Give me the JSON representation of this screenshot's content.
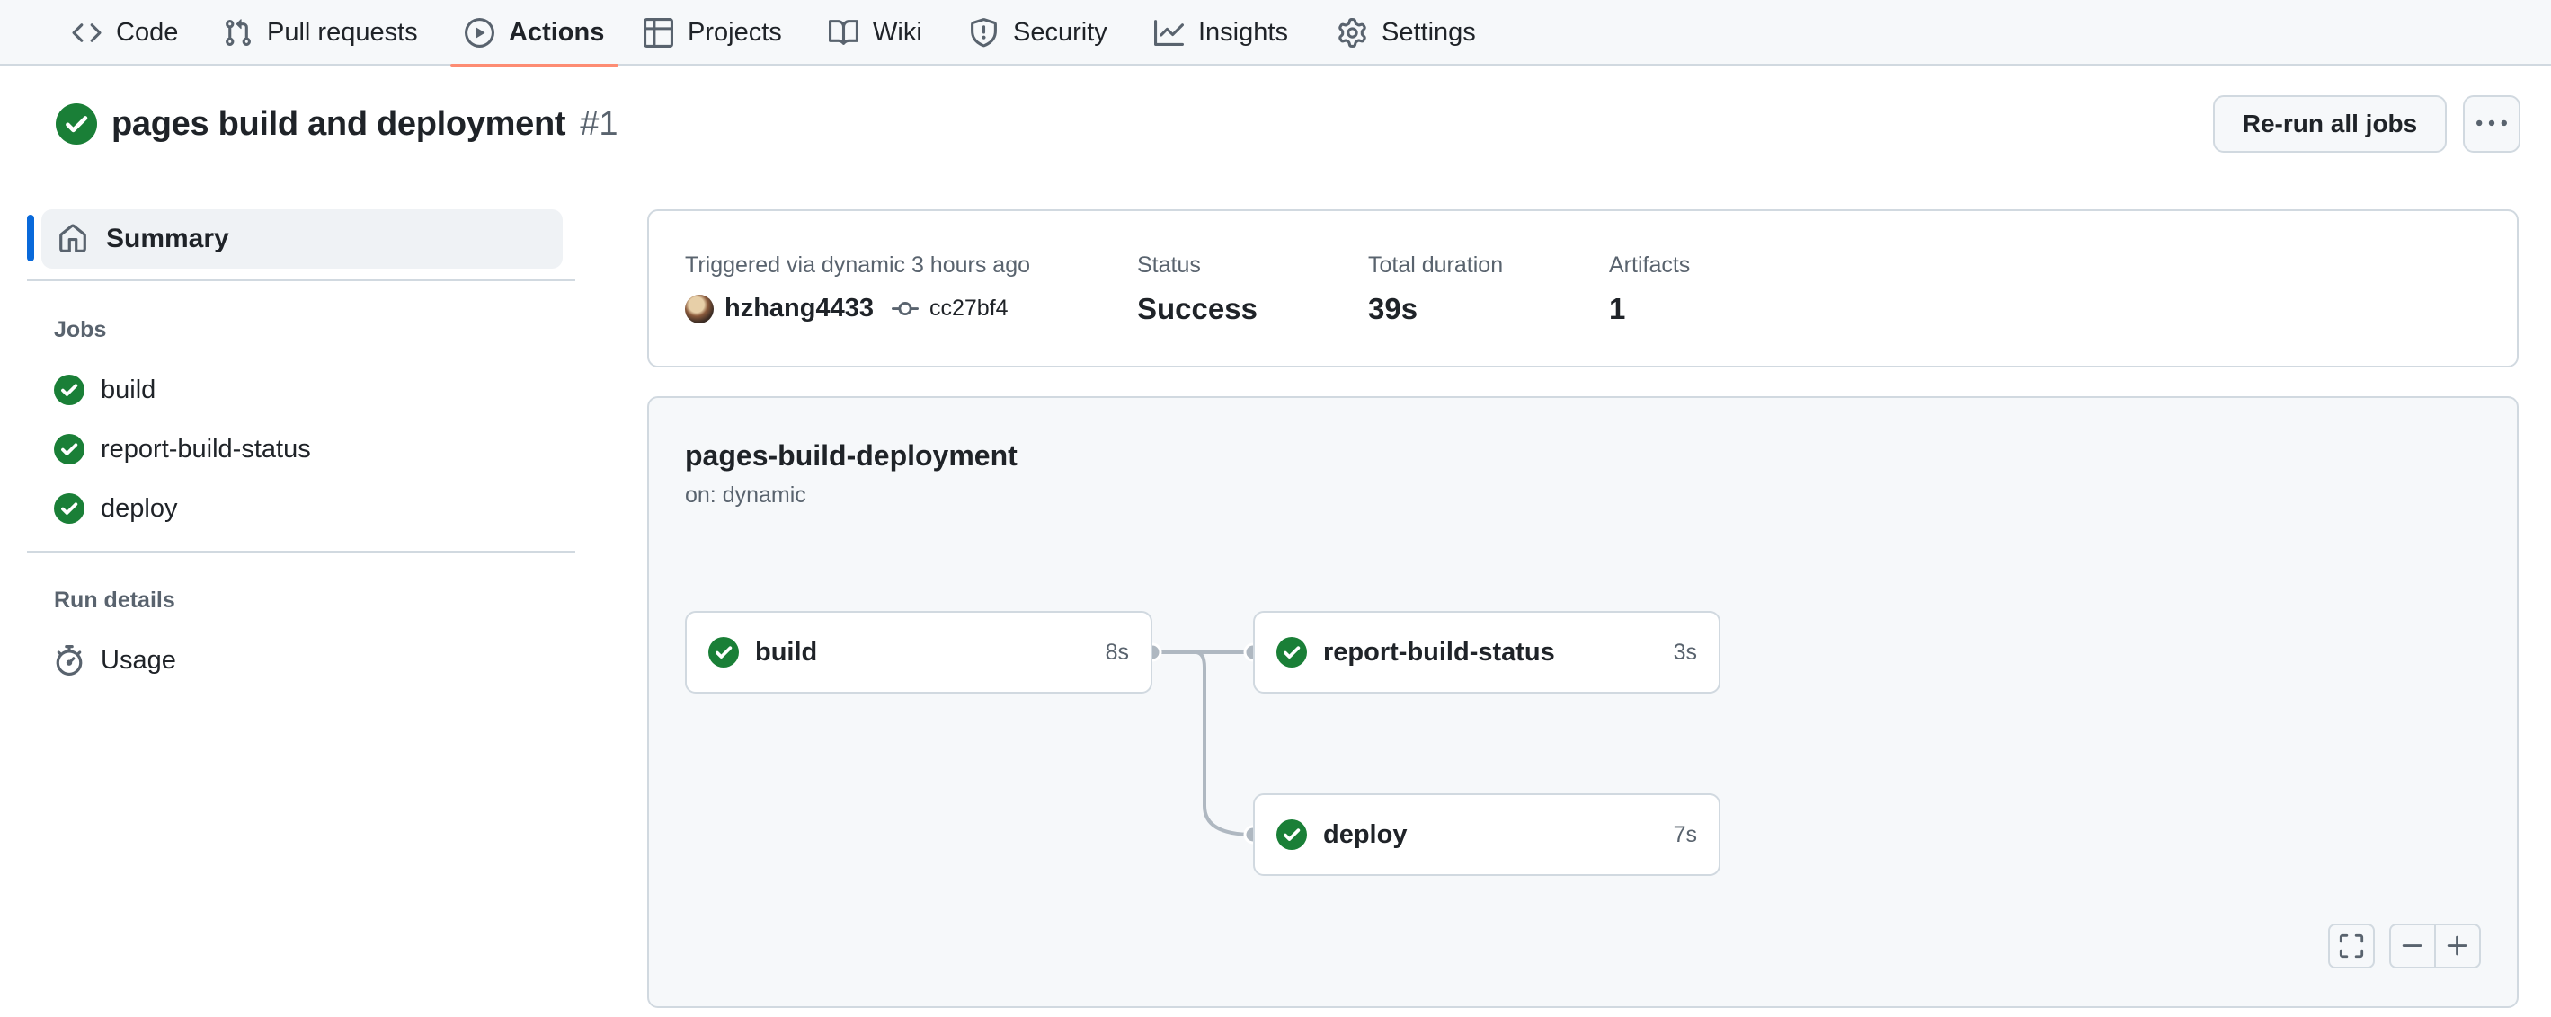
{
  "nav": {
    "items": [
      {
        "label": "Code",
        "icon": "code-icon"
      },
      {
        "label": "Pull requests",
        "icon": "git-pull-request-icon"
      },
      {
        "label": "Actions",
        "icon": "play-icon",
        "active": true
      },
      {
        "label": "Projects",
        "icon": "table-icon"
      },
      {
        "label": "Wiki",
        "icon": "book-icon"
      },
      {
        "label": "Security",
        "icon": "shield-icon"
      },
      {
        "label": "Insights",
        "icon": "graph-icon"
      },
      {
        "label": "Settings",
        "icon": "gear-icon"
      }
    ]
  },
  "run": {
    "title": "pages build and deployment",
    "number": "#1",
    "rerun_label": "Re-run all jobs",
    "status_icon": "check-circle-fill-icon"
  },
  "sidebar": {
    "summary_label": "Summary",
    "jobs_heading": "Jobs",
    "jobs": [
      {
        "name": "build"
      },
      {
        "name": "report-build-status"
      },
      {
        "name": "deploy"
      }
    ],
    "run_details_heading": "Run details",
    "usage_label": "Usage"
  },
  "summary": {
    "triggered_label": "Triggered via dynamic 3 hours ago",
    "actor": "hzhang4433",
    "commit": "cc27bf4",
    "status_label": "Status",
    "status_value": "Success",
    "duration_label": "Total duration",
    "duration_value": "39s",
    "artifacts_label": "Artifacts",
    "artifacts_value": "1"
  },
  "workflow": {
    "name": "pages-build-deployment",
    "trigger": "on: dynamic",
    "jobs": [
      {
        "name": "build",
        "duration": "8s"
      },
      {
        "name": "report-build-status",
        "duration": "3s"
      },
      {
        "name": "deploy",
        "duration": "7s"
      }
    ]
  },
  "colors": {
    "success": "#1a7f37",
    "accent_underline": "#fd8c73",
    "selected_bar": "#0969da",
    "connector": "#afb8c1"
  }
}
